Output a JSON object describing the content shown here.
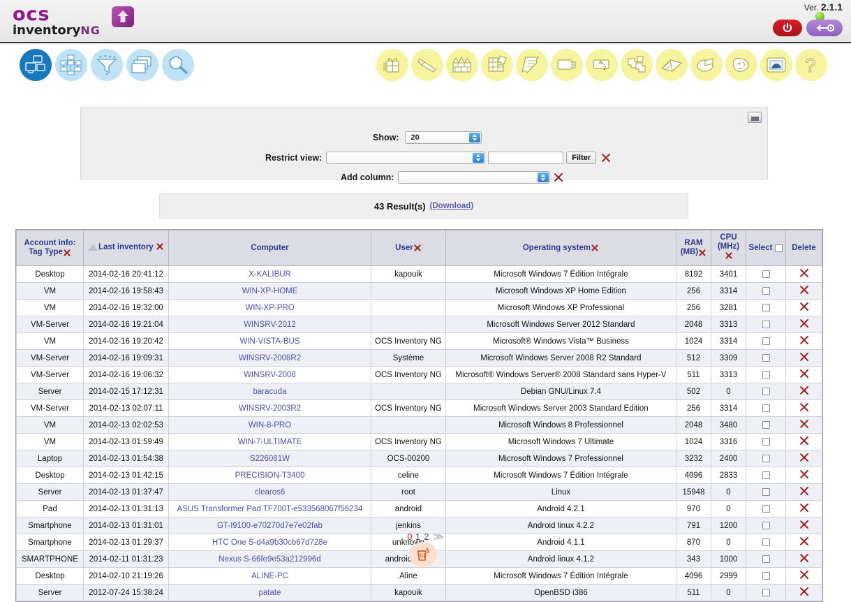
{
  "header": {
    "logo_ocs": "ocs",
    "logo_inventory": "inventory",
    "logo_ng": "NG",
    "version_label": "Ver.",
    "version": "2.1.1",
    "status_dot": "online-green",
    "power_button": "logout-power-button",
    "key_button": "credentials-key-button"
  },
  "nav_primary": [
    {
      "name": "computers-icon",
      "label": "Computers",
      "active": true
    },
    {
      "name": "tree-view-icon",
      "label": "Tree view",
      "active": false
    },
    {
      "name": "funnel-filter-icon",
      "label": "Filter",
      "active": false
    },
    {
      "name": "windows-group-icon",
      "label": "Groups",
      "active": false
    },
    {
      "name": "magnifier-search-icon",
      "label": "Search",
      "active": false
    }
  ],
  "nav_tools": [
    {
      "name": "gift-package-icon",
      "label": "Deployment"
    },
    {
      "name": "wrench-tool-icon",
      "label": "Configuration"
    },
    {
      "name": "firewall-chart-icon",
      "label": "Network"
    },
    {
      "name": "blocks-grid-icon",
      "label": "Inventory"
    },
    {
      "name": "scroll-document-icon",
      "label": "Logs"
    },
    {
      "name": "printer-icon",
      "label": "Printers"
    },
    {
      "name": "a-to-z-icon",
      "label": "Dictionary"
    },
    {
      "name": "puzzle-pieces-icon",
      "label": "Plugins"
    },
    {
      "name": "open-book-icon",
      "label": "Documentation"
    },
    {
      "name": "pie-chart-icon",
      "label": "Statistics"
    },
    {
      "name": "face-profile-icon",
      "label": "Users"
    },
    {
      "name": "picture-frame-icon",
      "label": "Screens"
    },
    {
      "name": "question-mark-icon",
      "label": "Help"
    }
  ],
  "filter_panel": {
    "minimize_button": "minimize-panel",
    "show_label": "Show:",
    "show_value": "20",
    "restrict_label": "Restrict view:",
    "restrict_select_value": "",
    "restrict_text_value": "",
    "filter_button": "Filter",
    "add_column_label": "Add column:",
    "add_column_value": "",
    "clear_restrict": "clear-restrict-view",
    "clear_add_column": "clear-add-column"
  },
  "results": {
    "count_text": "43 Result(s)",
    "download_text": "(Download)"
  },
  "table": {
    "headers": [
      {
        "label": "Account info:",
        "label2": "Tag Type",
        "removable": true,
        "sorted": false
      },
      {
        "label": "Last inventory",
        "removable": true,
        "sorted": true
      },
      {
        "label": "Computer",
        "removable": false,
        "sorted": false
      },
      {
        "label": "User",
        "removable": true,
        "sorted": false
      },
      {
        "label": "Operating system",
        "removable": true,
        "sorted": false
      },
      {
        "label": "RAM",
        "label2": "(MB)",
        "removable": true,
        "sorted": false
      },
      {
        "label": "CPU",
        "label2": "(MHz)",
        "removable": true,
        "sorted": false
      },
      {
        "label": "Select",
        "removable": false,
        "sorted": false
      },
      {
        "label": "Delete",
        "removable": false,
        "sorted": false
      }
    ],
    "rows": [
      {
        "tag": "Desktop",
        "date": "2014-02-16 20:41:12",
        "computer": "X-KALIBUR",
        "user": "kapouik",
        "os": "Microsoft Windows 7 Édition Intégrale",
        "ram": "8192",
        "cpu": "3401"
      },
      {
        "tag": "VM",
        "date": "2014-02-16 19:58:43",
        "computer": "WIN-XP-HOME",
        "user": "",
        "os": "Microsoft Windows XP Home Edition",
        "ram": "256",
        "cpu": "3314"
      },
      {
        "tag": "VM",
        "date": "2014-02-16 19:32:00",
        "computer": "WIN-XP-PRO",
        "user": "",
        "os": "Microsoft Windows XP Professional",
        "ram": "256",
        "cpu": "3281"
      },
      {
        "tag": "VM-Server",
        "date": "2014-02-16 19:21:04",
        "computer": "WINSRV-2012",
        "user": "",
        "os": "Microsoft Windows Server 2012 Standard",
        "ram": "2048",
        "cpu": "3313"
      },
      {
        "tag": "VM",
        "date": "2014-02-16 19:20:42",
        "computer": "WIN-VISTA-BUS",
        "user": "OCS Inventory NG",
        "os": "Microsoft® Windows Vista™ Business",
        "ram": "1024",
        "cpu": "3314"
      },
      {
        "tag": "VM-Server",
        "date": "2014-02-16 19:09:31",
        "computer": "WINSRV-2008R2",
        "user": "Système",
        "os": "Microsoft Windows Server 2008 R2 Standard",
        "ram": "512",
        "cpu": "3309"
      },
      {
        "tag": "VM-Server",
        "date": "2014-02-16 19:06:32",
        "computer": "WINSRV-2008",
        "user": "OCS Inventory NG",
        "os": "Microsoft® Windows Server® 2008 Standard sans Hyper-V",
        "ram": "511",
        "cpu": "3313"
      },
      {
        "tag": "Server",
        "date": "2014-02-15 17:12:31",
        "computer": "baracuda",
        "user": "",
        "os": "Debian GNU/Linux 7.4",
        "ram": "502",
        "cpu": "0"
      },
      {
        "tag": "VM-Server",
        "date": "2014-02-13 02:07:11",
        "computer": "WINSRV-2003R2",
        "user": "OCS Inventory NG",
        "os": "Microsoft Windows Server 2003 Standard Edition",
        "ram": "256",
        "cpu": "3314"
      },
      {
        "tag": "VM",
        "date": "2014-02-13 02:02:53",
        "computer": "WIN-8-PRO",
        "user": "",
        "os": "Microsoft Windows 8 Professionnel",
        "ram": "2048",
        "cpu": "3480"
      },
      {
        "tag": "VM",
        "date": "2014-02-13 01:59:49",
        "computer": "WIN-7-ULTIMATE",
        "user": "OCS Inventory NG",
        "os": "Microsoft Windows 7 Ultimate",
        "ram": "1024",
        "cpu": "3316"
      },
      {
        "tag": "Laptop",
        "date": "2014-02-13 01:54:38",
        "computer": "S226081W",
        "user": "OCS-00200",
        "os": "Microsoft Windows 7 Professionnel",
        "ram": "3232",
        "cpu": "2400"
      },
      {
        "tag": "Desktop",
        "date": "2014-02-13 01:42:15",
        "computer": "PRECISION-T3400",
        "user": "celine",
        "os": "Microsoft Windows 7 Édition Intégrale",
        "ram": "4096",
        "cpu": "2833"
      },
      {
        "tag": "Server",
        "date": "2014-02-13 01:37:47",
        "computer": "clearos6",
        "user": "root",
        "os": "Linux",
        "ram": "15948",
        "cpu": "0"
      },
      {
        "tag": "Pad",
        "date": "2014-02-13 01:31:13",
        "computer": "ASUS Transformer Pad TF700T-e533568067f56234",
        "user": "android",
        "os": "Android 4.2.1",
        "ram": "970",
        "cpu": "0"
      },
      {
        "tag": "Smartphone",
        "date": "2014-02-13 01:31:01",
        "computer": "GT-I9100-e70270d7e7e02fab",
        "user": "jenkins",
        "os": "Android linux 4.2.2",
        "ram": "791",
        "cpu": "1200"
      },
      {
        "tag": "Smartphone",
        "date": "2014-02-13 01:29:37",
        "computer": "HTC One S-d4a9b30cb67d728e",
        "user": "unknown",
        "os": "Android 4.1.1",
        "ram": "870",
        "cpu": "0"
      },
      {
        "tag": "SMARTPHONE",
        "date": "2014-02-11 01:31:23",
        "computer": "Nexus S-66fe9e53a212996d",
        "user": "android-build",
        "os": "Android linux 4.1.2",
        "ram": "343",
        "cpu": "1000"
      },
      {
        "tag": "Desktop",
        "date": "2014-02-10 21:19:26",
        "computer": "ALINE-PC",
        "user": "Aline",
        "os": "Microsoft Windows 7 Édition Intégrale",
        "ram": "4096",
        "cpu": "2999"
      },
      {
        "tag": "Server",
        "date": "2012-07-24 15:38:24",
        "computer": "patate",
        "user": "kapouik",
        "os": "OpenBSD i386",
        "ram": "511",
        "cpu": "0"
      }
    ]
  },
  "pagination": {
    "current": "0",
    "pages": [
      "1",
      "2"
    ],
    "next_label": "≫"
  },
  "footer": {
    "trash_button": "delete-selected-trash"
  }
}
